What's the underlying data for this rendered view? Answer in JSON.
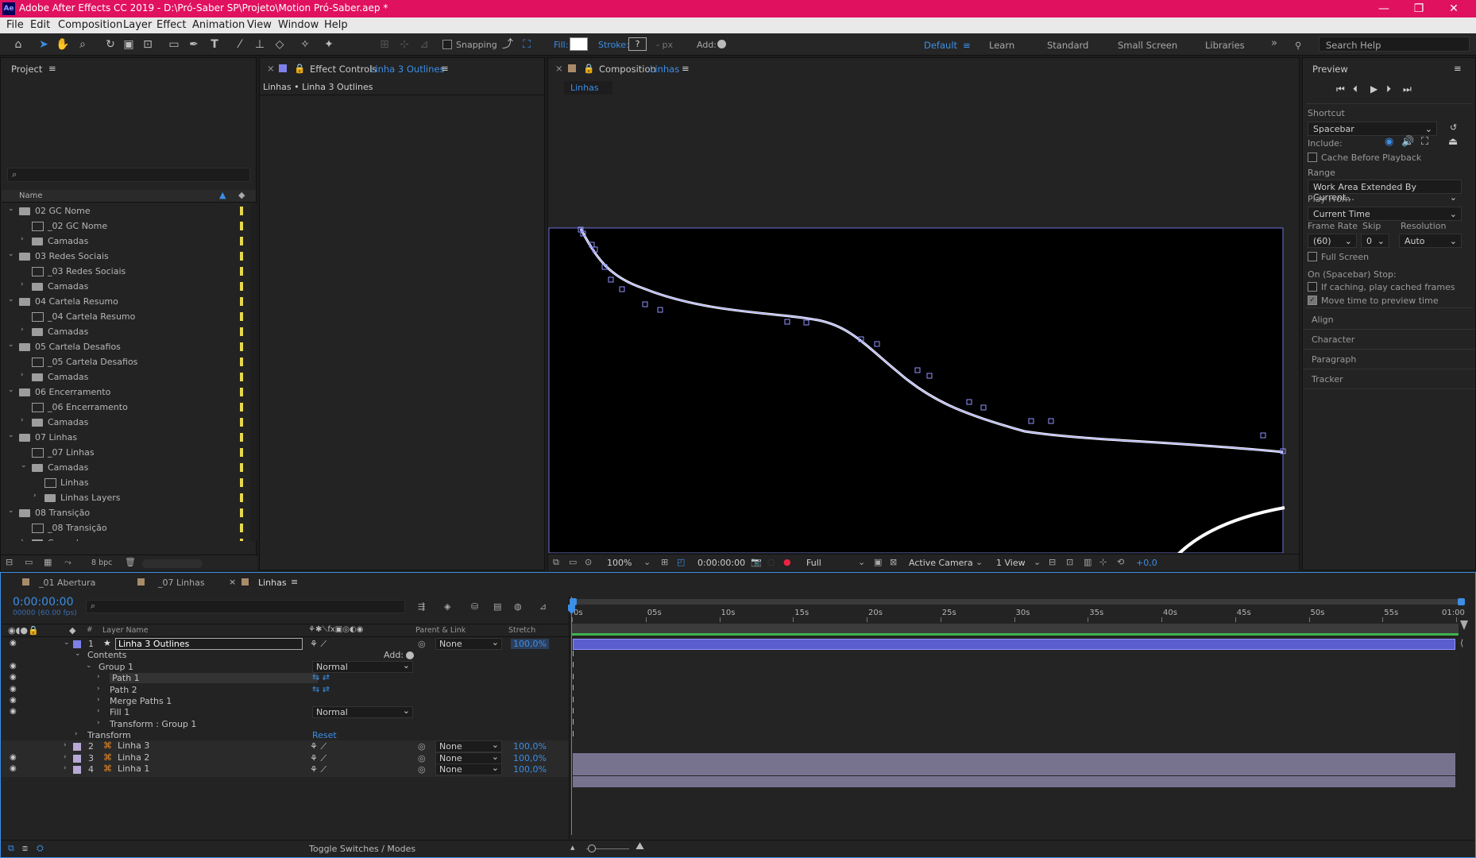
{
  "title_bar": {
    "app_icon": "Ae",
    "title": "Adobe After Effects CC 2019 - D:\\Pró-Saber SP\\Projeto\\Motion Pró-Saber.aep *",
    "minimize": "—",
    "restore": "❐",
    "close": "✕"
  },
  "menu": [
    "File",
    "Edit",
    "Composition",
    "Layer",
    "Effect",
    "Animation",
    "View",
    "Window",
    "Help"
  ],
  "toolbar": {
    "snapping": "Snapping",
    "fill_label": "Fill:",
    "stroke_label": "Stroke:",
    "stroke_value": "?",
    "px_label": "- px",
    "add_label": "Add:",
    "workspaces": [
      "Default",
      "Learn",
      "Standard",
      "Small Screen",
      "Libraries"
    ],
    "active_workspace": "Default",
    "search_placeholder": "Search Help"
  },
  "project": {
    "title": "Project",
    "col_name": "Name",
    "bpc": "8 bpc",
    "items": [
      {
        "label": "02 GC Nome",
        "kind": "folder",
        "indent": 0,
        "open": true
      },
      {
        "label": "_02 GC Nome",
        "kind": "comp",
        "indent": 1
      },
      {
        "label": "Camadas",
        "kind": "folder",
        "indent": 1,
        "open": false
      },
      {
        "label": "03 Redes Sociais",
        "kind": "folder",
        "indent": 0,
        "open": true
      },
      {
        "label": "_03 Redes Sociais",
        "kind": "comp",
        "indent": 1
      },
      {
        "label": "Camadas",
        "kind": "folder",
        "indent": 1,
        "open": false
      },
      {
        "label": "04 Cartela Resumo",
        "kind": "folder",
        "indent": 0,
        "open": true
      },
      {
        "label": "_04 Cartela Resumo",
        "kind": "comp",
        "indent": 1
      },
      {
        "label": "Camadas",
        "kind": "folder",
        "indent": 1,
        "open": false
      },
      {
        "label": "05 Cartela Desafios",
        "kind": "folder",
        "indent": 0,
        "open": true
      },
      {
        "label": "_05 Cartela Desafios",
        "kind": "comp",
        "indent": 1
      },
      {
        "label": "Camadas",
        "kind": "folder",
        "indent": 1,
        "open": false
      },
      {
        "label": "06 Encerramento",
        "kind": "folder",
        "indent": 0,
        "open": true
      },
      {
        "label": "_06 Encerramento",
        "kind": "comp",
        "indent": 1
      },
      {
        "label": "Camadas",
        "kind": "folder",
        "indent": 1,
        "open": false
      },
      {
        "label": "07 Linhas",
        "kind": "folder",
        "indent": 0,
        "open": true
      },
      {
        "label": "_07 Linhas",
        "kind": "comp",
        "indent": 1
      },
      {
        "label": "Camadas",
        "kind": "folder",
        "indent": 1,
        "open": true
      },
      {
        "label": "Linhas",
        "kind": "comp",
        "indent": 2
      },
      {
        "label": "Linhas Layers",
        "kind": "folder",
        "indent": 2,
        "open": false
      },
      {
        "label": "08 Transição",
        "kind": "folder",
        "indent": 0,
        "open": true
      },
      {
        "label": "_08 Transição",
        "kind": "comp",
        "indent": 1
      },
      {
        "label": "Camadas",
        "kind": "folder",
        "indent": 1,
        "open": false
      }
    ]
  },
  "effect_controls": {
    "prefix": "Effect Controls",
    "layer": "Linha 3 Outlines",
    "breadcrumb": "Linhas • Linha 3 Outlines"
  },
  "composition": {
    "prefix": "Composition",
    "name": "Linhas",
    "tab": "Linhas",
    "zoom": "100%",
    "timecode": "0:00:00:00",
    "quality": "Full",
    "camera": "Active Camera",
    "views": "1 View",
    "exposure": "+0,0"
  },
  "preview": {
    "title": "Preview",
    "shortcut_label": "Shortcut",
    "shortcut": "Spacebar",
    "include_label": "Include:",
    "cache_label": "Cache Before Playback",
    "range_label": "Range",
    "range": "Work Area Extended By Current...",
    "play_from_label": "Play From",
    "play_from": "Current Time",
    "frame_rate_label": "Frame Rate",
    "skip_label": "Skip",
    "resolution_label": "Resolution",
    "frame_rate": "(60)",
    "skip": "0",
    "resolution": "Auto",
    "full_screen": "Full Screen",
    "stop_label": "On (Spacebar) Stop:",
    "if_caching": "If caching, play cached frames",
    "move_time": "Move time to preview time",
    "sections": [
      "Align",
      "Character",
      "Paragraph",
      "Tracker"
    ]
  },
  "timeline": {
    "tabs": [
      "_01 Abertura",
      "_07 Linhas",
      "Linhas"
    ],
    "active_tab": "Linhas",
    "timecode": "0:00:00:00",
    "fps": "00000 (60.00 fps)",
    "col_layer_name": "Layer Name",
    "col_parent": "Parent & Link",
    "col_stretch": "Stretch",
    "col_num": "#",
    "ruler": [
      "0s",
      "05s",
      "10s",
      "15s",
      "20s",
      "25s",
      "30s",
      "35s",
      "40s",
      "45s",
      "50s",
      "55s",
      "01:00"
    ],
    "add_label": "Add:",
    "reset": "Reset",
    "toggle": "Toggle Switches / Modes",
    "rows": [
      {
        "num": "1",
        "label": "Linha 3 Outlines",
        "kind": "layer",
        "star": true,
        "parent": "None",
        "stretch": "100,0%",
        "open": true,
        "selected": true
      },
      {
        "label": "Contents",
        "kind": "prop",
        "indent": 1,
        "open": true,
        "eye": false
      },
      {
        "label": "Group 1",
        "kind": "prop",
        "indent": 2,
        "open": true,
        "eye": true,
        "mode": "Normal"
      },
      {
        "label": "Path 1",
        "kind": "prop",
        "indent": 3,
        "open": false,
        "eye": true,
        "pathicons": true,
        "highlight": true
      },
      {
        "label": "Path 2",
        "kind": "prop",
        "indent": 3,
        "open": false,
        "eye": true,
        "pathicons": true
      },
      {
        "label": "Merge Paths 1",
        "kind": "prop",
        "indent": 3,
        "open": false,
        "eye": true
      },
      {
        "label": "Fill 1",
        "kind": "prop",
        "indent": 3,
        "open": false,
        "eye": true,
        "mode": "Normal"
      },
      {
        "label": "Transform : Group 1",
        "kind": "prop",
        "indent": 3,
        "open": false,
        "eye": false
      },
      {
        "label": "Transform",
        "kind": "prop",
        "indent": 1,
        "open": false,
        "eye": false,
        "reset": true
      },
      {
        "num": "2",
        "label": "Linha 3",
        "kind": "layer",
        "parent": "None",
        "stretch": "100,0%",
        "eye": false
      },
      {
        "num": "3",
        "label": "Linha 2",
        "kind": "layer",
        "parent": "None",
        "stretch": "100,0%",
        "eye": true
      },
      {
        "num": "4",
        "label": "Linha 1",
        "kind": "layer",
        "parent": "None",
        "stretch": "100,0%",
        "eye": true
      }
    ]
  }
}
